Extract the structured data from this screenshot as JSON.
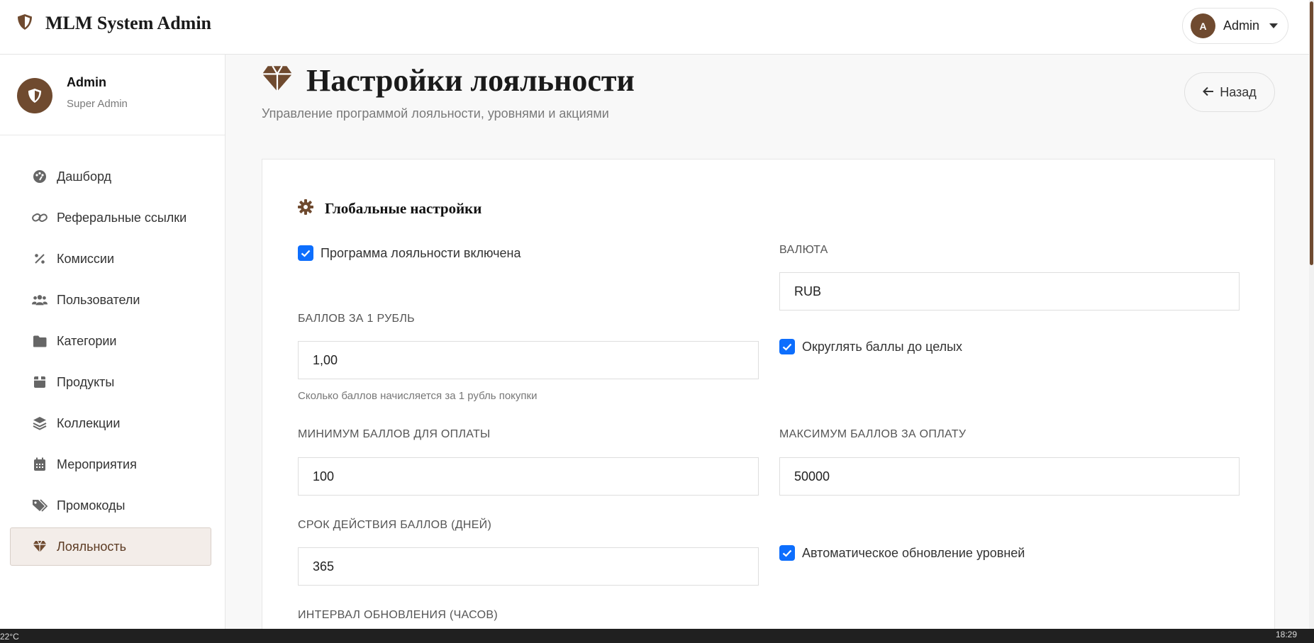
{
  "header": {
    "title": "MLM System Admin",
    "user_initial": "A",
    "user_name": "Admin"
  },
  "profile": {
    "name": "Admin",
    "role": "Super Admin"
  },
  "sidebar": {
    "items": [
      {
        "label": "Дашборд",
        "icon": "palette-icon"
      },
      {
        "label": "Реферальные ссылки",
        "icon": "link-icon"
      },
      {
        "label": "Комиссии",
        "icon": "percent-icon"
      },
      {
        "label": "Пользователи",
        "icon": "users-icon"
      },
      {
        "label": "Категории",
        "icon": "folder-icon"
      },
      {
        "label": "Продукты",
        "icon": "box-icon"
      },
      {
        "label": "Коллекции",
        "icon": "layers-icon"
      },
      {
        "label": "Мероприятия",
        "icon": "calendar-icon"
      },
      {
        "label": "Промокоды",
        "icon": "tags-icon"
      },
      {
        "label": "Лояльность",
        "icon": "gem-icon",
        "active": true
      }
    ]
  },
  "page": {
    "title": "Настройки лояльности",
    "subtitle": "Управление программой лояльности, уровнями и акциями",
    "back_label": "Назад"
  },
  "global": {
    "section_title": "Глобальные настройки",
    "loyalty_enabled_label": "Программа лояльности включена",
    "currency_label": "ВАЛЮТА",
    "currency_value": "RUB",
    "points_per_ruble_label": "БАЛЛОВ ЗА 1 РУБЛЬ",
    "points_per_ruble_value": "1,00",
    "points_per_ruble_help": "Сколько баллов начисляется за 1 рубль покупки",
    "round_points_label": "Округлять баллы до целых",
    "min_points_label": "МИНИМУМ БАЛЛОВ ДЛЯ ОПЛАТЫ",
    "min_points_value": "100",
    "max_points_label": "МАКСИМУМ БАЛЛОВ ЗА ОПЛАТУ",
    "max_points_value": "50000",
    "expiry_label": "СРОК ДЕЙСТВИЯ БАЛЛОВ (ДНЕЙ)",
    "expiry_value": "365",
    "auto_update_label": "Автоматическое обновление уровней",
    "interval_label": "ИНТЕРВАЛ ОБНОВЛЕНИЯ (ЧАСОВ)"
  },
  "taskbar": {
    "temp": "22°C",
    "time": "18:29"
  },
  "colors": {
    "brand": "#6f4a2f",
    "checkbox": "#0d6efd",
    "active_bg": "#f3ede9"
  }
}
